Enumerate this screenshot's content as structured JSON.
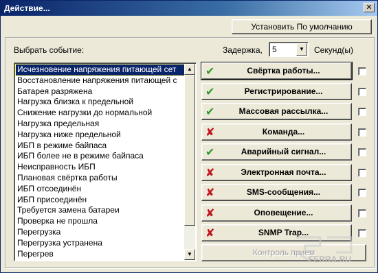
{
  "window": {
    "title": "Действие...",
    "close_glyph": "✕"
  },
  "default_button": "Установить По умолчанию",
  "event_label": "Выбрать событие:",
  "delay": {
    "label": "Задержка,",
    "value": "5",
    "unit": "Секунд(ы)"
  },
  "events": [
    "Исчезновение напряжения питающей сет",
    "Восстановление напряжения питающей с",
    "Батарея разряжена",
    "Нагрузка близка к предельной",
    "Снижение нагрузки до нормальной",
    "Нагрузка предельная",
    "Нагрузка ниже предельной",
    "ИБП в режиме байпаса",
    "ИБП более не в режиме байпаса",
    "Неисправность ИБП",
    "Плановая свёртка работы",
    "ИБП отсоединён",
    "ИБП присоединён",
    "Требуется замена батареи",
    "Проверка не прошла",
    "Перегрузка",
    "Перегрузка устранена",
    "Перегрев"
  ],
  "selected_event_index": 0,
  "actions": [
    {
      "label": "Свёртка работы...",
      "icon": "check-icon",
      "enabled": true
    },
    {
      "label": "Регистрирование...",
      "icon": "check-icon",
      "enabled": true
    },
    {
      "label": "Массовая рассылка...",
      "icon": "check-icon",
      "enabled": true
    },
    {
      "label": "Команда...",
      "icon": "cross-icon",
      "enabled": false
    },
    {
      "label": "Аварийный сигнал...",
      "icon": "check-icon",
      "enabled": true
    },
    {
      "label": "Электронная почта...",
      "icon": "cross-icon",
      "enabled": false
    },
    {
      "label": "SMS-сообщения...",
      "icon": "cross-icon",
      "enabled": false
    },
    {
      "label": "Оповещение...",
      "icon": "cross-icon",
      "enabled": false
    },
    {
      "label": "SNMP Trap...",
      "icon": "cross-icon",
      "enabled": false
    }
  ],
  "control_button": "Контроль прием",
  "watermark": "FERRA.RU",
  "colors": {
    "check": "#2a9a2a",
    "cross": "#c0141c",
    "selection": "#0a246a"
  }
}
